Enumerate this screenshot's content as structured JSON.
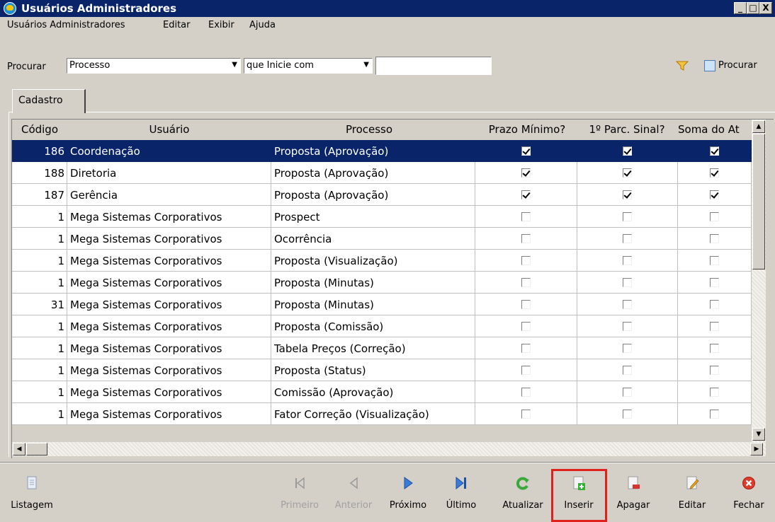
{
  "window": {
    "title": "Usuários Administradores",
    "controls": [
      "_",
      "□",
      "X"
    ]
  },
  "menu": [
    "Usuários Administradores",
    "Editar",
    "Exibir",
    "Ajuda"
  ],
  "search": {
    "label": "Procurar",
    "field": "Processo",
    "mode": "que Inicie com",
    "value": "",
    "button": "Procurar",
    "icons": [
      "funnel-icon",
      "search-icon"
    ]
  },
  "tab": "Cadastro",
  "grid": {
    "columns": [
      "Código",
      "Usuário",
      "Processo",
      "Prazo Mínimo?",
      "1º Parc. Sinal?",
      "Soma do At"
    ],
    "rows": [
      {
        "codigo": "186",
        "usuario": "Coordenação",
        "processo": "Proposta (Aprovação)",
        "c1": true,
        "c2": true,
        "c3": true,
        "selected": true
      },
      {
        "codigo": "188",
        "usuario": "Diretoria",
        "processo": "Proposta (Aprovação)",
        "c1": true,
        "c2": true,
        "c3": true
      },
      {
        "codigo": "187",
        "usuario": "Gerência",
        "processo": "Proposta (Aprovação)",
        "c1": true,
        "c2": true,
        "c3": true
      },
      {
        "codigo": "1",
        "usuario": "Mega Sistemas Corporativos",
        "processo": "Prospect",
        "c1": false,
        "c2": false,
        "c3": false
      },
      {
        "codigo": "1",
        "usuario": "Mega Sistemas Corporativos",
        "processo": "Ocorrência",
        "c1": false,
        "c2": false,
        "c3": false
      },
      {
        "codigo": "1",
        "usuario": "Mega Sistemas Corporativos",
        "processo": "Proposta (Visualização)",
        "c1": false,
        "c2": false,
        "c3": false
      },
      {
        "codigo": "1",
        "usuario": "Mega Sistemas Corporativos",
        "processo": "Proposta (Minutas)",
        "c1": false,
        "c2": false,
        "c3": false
      },
      {
        "codigo": "31",
        "usuario": "Mega Sistemas Corporativos",
        "processo": "Proposta (Minutas)",
        "c1": false,
        "c2": false,
        "c3": false
      },
      {
        "codigo": "1",
        "usuario": "Mega Sistemas Corporativos",
        "processo": "Proposta (Comissão)",
        "c1": false,
        "c2": false,
        "c3": false
      },
      {
        "codigo": "1",
        "usuario": "Mega Sistemas Corporativos",
        "processo": "Tabela Preços (Correção)",
        "c1": false,
        "c2": false,
        "c3": false
      },
      {
        "codigo": "1",
        "usuario": "Mega Sistemas Corporativos",
        "processo": "Proposta (Status)",
        "c1": false,
        "c2": false,
        "c3": false
      },
      {
        "codigo": "1",
        "usuario": "Mega Sistemas Corporativos",
        "processo": "Comissão (Aprovação)",
        "c1": false,
        "c2": false,
        "c3": false
      },
      {
        "codigo": "1",
        "usuario": "Mega Sistemas Corporativos",
        "processo": "Fator Correção (Visualização)",
        "c1": false,
        "c2": false,
        "c3": false
      }
    ]
  },
  "toolbar": [
    {
      "label": "Listagem",
      "icon": "document-icon",
      "enabled": true
    },
    {
      "label": "Primeiro",
      "icon": "first-icon",
      "enabled": false
    },
    {
      "label": "Anterior",
      "icon": "previous-icon",
      "enabled": false
    },
    {
      "label": "Próximo",
      "icon": "next-icon",
      "enabled": true
    },
    {
      "label": "Último",
      "icon": "last-icon",
      "enabled": true
    },
    {
      "label": "Atualizar",
      "icon": "refresh-icon",
      "enabled": true
    },
    {
      "label": "Inserir",
      "icon": "insert-icon",
      "enabled": true,
      "highlighted": true
    },
    {
      "label": "Apagar",
      "icon": "delete-icon",
      "enabled": true
    },
    {
      "label": "Editar",
      "icon": "edit-icon",
      "enabled": true
    },
    {
      "label": "Fechar",
      "icon": "close-icon",
      "enabled": true
    }
  ],
  "colors": {
    "title_bar": "#0a246a",
    "selection": "#0a246a",
    "highlight_box": "#e0201a"
  }
}
